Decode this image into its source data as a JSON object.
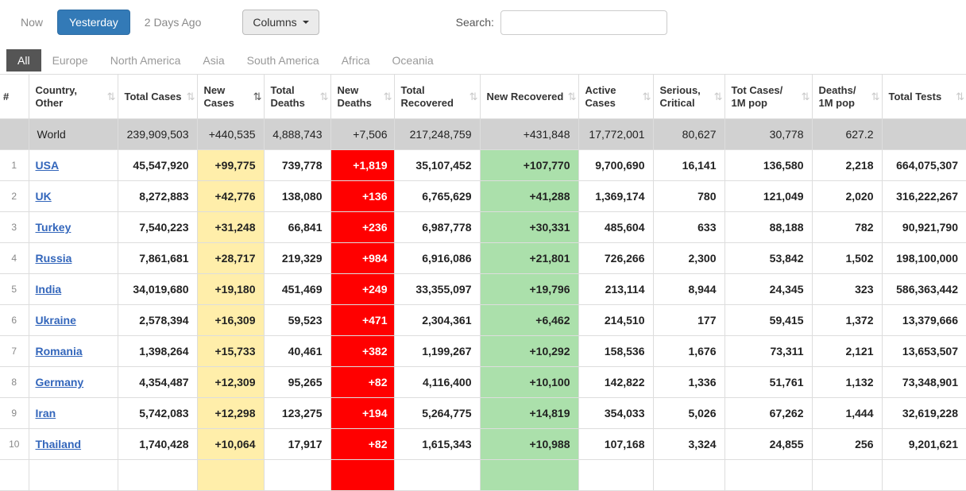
{
  "toolbar": {
    "now_label": "Now",
    "yesterday_label": "Yesterday",
    "two_days_ago_label": "2 Days Ago",
    "columns_label": "Columns",
    "search_label": "Search:",
    "search_value": ""
  },
  "tabs": [
    {
      "label": "All",
      "active": true
    },
    {
      "label": "Europe",
      "active": false
    },
    {
      "label": "North America",
      "active": false
    },
    {
      "label": "Asia",
      "active": false
    },
    {
      "label": "South America",
      "active": false
    },
    {
      "label": "Africa",
      "active": false
    },
    {
      "label": "Oceania",
      "active": false
    }
  ],
  "table": {
    "headers": [
      {
        "key": "rank",
        "label": "#",
        "sortable": false,
        "sorted": false
      },
      {
        "key": "country",
        "label": "Country, Other",
        "sortable": true,
        "sorted": false
      },
      {
        "key": "total-cases",
        "label": "Total Cases",
        "sortable": true,
        "sorted": false
      },
      {
        "key": "new-cases",
        "label": "New Cases",
        "sortable": true,
        "sorted": true
      },
      {
        "key": "total-deaths",
        "label": "Total Deaths",
        "sortable": true,
        "sorted": false
      },
      {
        "key": "new-deaths",
        "label": "New Deaths",
        "sortable": true,
        "sorted": false
      },
      {
        "key": "total-recovered",
        "label": "Total Recovered",
        "sortable": true,
        "sorted": false
      },
      {
        "key": "new-recovered",
        "label": "New Recovered",
        "sortable": true,
        "sorted": false
      },
      {
        "key": "active-cases",
        "label": "Active Cases",
        "sortable": true,
        "sorted": false
      },
      {
        "key": "serious-critical",
        "label": "Serious, Critical",
        "sortable": true,
        "sorted": false
      },
      {
        "key": "tot-cases-1m",
        "label": "Tot Cases/ 1M pop",
        "sortable": true,
        "sorted": false
      },
      {
        "key": "deaths-1m",
        "label": "Deaths/ 1M pop",
        "sortable": true,
        "sorted": false
      },
      {
        "key": "total-tests",
        "label": "Total Tests",
        "sortable": true,
        "sorted": false
      }
    ],
    "cell_keys": [
      "total-cases",
      "new-cases",
      "total-deaths",
      "new-deaths",
      "total-recovered",
      "new-recovered",
      "active-cases",
      "serious-critical",
      "tot-cases-1m",
      "deaths-1m",
      "total-tests"
    ],
    "world_row": {
      "rank": "",
      "country": "World",
      "cells": [
        "239,909,503",
        "+440,535",
        "4,888,743",
        "+7,506",
        "217,248,759",
        "+431,848",
        "17,772,001",
        "80,627",
        "30,778",
        "627.2",
        ""
      ]
    },
    "rows": [
      {
        "rank": "1",
        "country": "USA",
        "cells": [
          "45,547,920",
          "+99,775",
          "739,778",
          "+1,819",
          "35,107,452",
          "+107,770",
          "9,700,690",
          "16,141",
          "136,580",
          "2,218",
          "664,075,307"
        ]
      },
      {
        "rank": "2",
        "country": "UK",
        "cells": [
          "8,272,883",
          "+42,776",
          "138,080",
          "+136",
          "6,765,629",
          "+41,288",
          "1,369,174",
          "780",
          "121,049",
          "2,020",
          "316,222,267"
        ]
      },
      {
        "rank": "3",
        "country": "Turkey",
        "cells": [
          "7,540,223",
          "+31,248",
          "66,841",
          "+236",
          "6,987,778",
          "+30,331",
          "485,604",
          "633",
          "88,188",
          "782",
          "90,921,790"
        ]
      },
      {
        "rank": "4",
        "country": "Russia",
        "cells": [
          "7,861,681",
          "+28,717",
          "219,329",
          "+984",
          "6,916,086",
          "+21,801",
          "726,266",
          "2,300",
          "53,842",
          "1,502",
          "198,100,000"
        ]
      },
      {
        "rank": "5",
        "country": "India",
        "cells": [
          "34,019,680",
          "+19,180",
          "451,469",
          "+249",
          "33,355,097",
          "+19,796",
          "213,114",
          "8,944",
          "24,345",
          "323",
          "586,363,442"
        ]
      },
      {
        "rank": "6",
        "country": "Ukraine",
        "cells": [
          "2,578,394",
          "+16,309",
          "59,523",
          "+471",
          "2,304,361",
          "+6,462",
          "214,510",
          "177",
          "59,415",
          "1,372",
          "13,379,666"
        ]
      },
      {
        "rank": "7",
        "country": "Romania",
        "cells": [
          "1,398,264",
          "+15,733",
          "40,461",
          "+382",
          "1,199,267",
          "+10,292",
          "158,536",
          "1,676",
          "73,311",
          "2,121",
          "13,653,507"
        ]
      },
      {
        "rank": "8",
        "country": "Germany",
        "cells": [
          "4,354,487",
          "+12,309",
          "95,265",
          "+82",
          "4,116,400",
          "+10,100",
          "142,822",
          "1,336",
          "51,761",
          "1,132",
          "73,348,901"
        ]
      },
      {
        "rank": "9",
        "country": "Iran",
        "cells": [
          "5,742,083",
          "+12,298",
          "123,275",
          "+194",
          "5,264,775",
          "+14,819",
          "354,033",
          "5,026",
          "67,262",
          "1,444",
          "32,619,228"
        ]
      },
      {
        "rank": "10",
        "country": "Thailand",
        "cells": [
          "1,740,428",
          "+10,064",
          "17,917",
          "+82",
          "1,615,343",
          "+10,988",
          "107,168",
          "3,324",
          "24,855",
          "256",
          "9,201,621"
        ]
      }
    ]
  },
  "icons": {
    "sort_icon": "⇅",
    "caret_down_icon": "caret-down"
  },
  "colors": {
    "accent": "#337ab7",
    "link": "#3366bb",
    "yellow": "#ffeeaa",
    "red": "#ff0000",
    "green": "#abe0ab",
    "worldgray": "#d1d1d1",
    "tabdark": "#555555"
  }
}
